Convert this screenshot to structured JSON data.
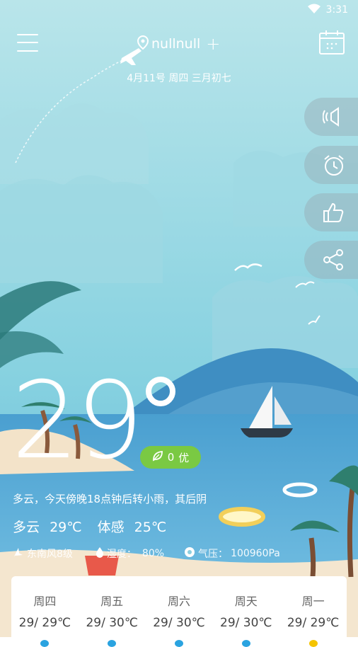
{
  "status_bar": {
    "time": "3:31",
    "wifi_icon": "wifi-icon"
  },
  "header": {
    "location": "nullnull",
    "add_label": "+",
    "date": "4月11号 周四 三月初七"
  },
  "side_buttons": [
    "speaker-icon",
    "alarm-clock-icon",
    "thumbs-up-icon",
    "share-icon"
  ],
  "current": {
    "temperature": "29",
    "aqi_value": "0",
    "aqi_level": "优",
    "summary": "多云，今天傍晚18点钟后转小雨，其后阴",
    "condition": "多云",
    "temp_text": "29℃",
    "feels_label": "体感",
    "feels_value": "25℃",
    "wind": "东南风8级",
    "humidity_label": "湿度：",
    "humidity_value": "80%",
    "pressure_label": "气压：",
    "pressure_value": "100960Pa"
  },
  "forecast": [
    {
      "day": "周四",
      "range": "29/ 29℃"
    },
    {
      "day": "周五",
      "range": "29/ 30℃"
    },
    {
      "day": "周六",
      "range": "29/ 30℃"
    },
    {
      "day": "周天",
      "range": "29/ 30℃"
    },
    {
      "day": "周一",
      "range": "29/ 29℃"
    }
  ],
  "colors": {
    "sky_top": "#b8e4ea",
    "sky_bottom": "#7fcfe0",
    "sea": "#4fa3cf",
    "aqi_green": "#7ac943",
    "sand": "#f4e6cf"
  }
}
